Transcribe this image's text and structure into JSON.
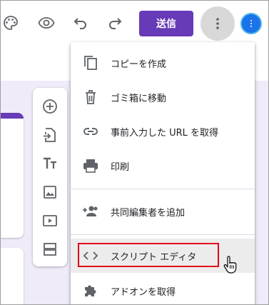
{
  "toolbar": {
    "send_label": "送信",
    "icons": [
      "palette-icon",
      "eye-icon",
      "undo-icon",
      "redo-icon",
      "more-vert-icon"
    ]
  },
  "float_toolbar": {
    "items": [
      "add-question-icon",
      "import-questions-icon",
      "title-text-icon",
      "image-icon",
      "video-icon",
      "section-icon"
    ]
  },
  "menu": {
    "items": [
      {
        "label": "コピーを作成",
        "icon": "copy-icon"
      },
      {
        "label": "ゴミ箱に移動",
        "icon": "trash-icon"
      },
      {
        "label": "事前入力した URL を取得",
        "icon": "link-icon"
      },
      {
        "label": "印刷",
        "icon": "print-icon"
      },
      {
        "label": "共同編集者を追加",
        "icon": "add-collaborator-icon"
      },
      {
        "label": "スクリプト エディタ",
        "icon": "code-icon"
      },
      {
        "label": "アドオンを取得",
        "icon": "puzzle-icon"
      }
    ]
  },
  "colors": {
    "accent": "#673ab7",
    "highlight": "#e0001a",
    "background": "#f0ebf8"
  }
}
